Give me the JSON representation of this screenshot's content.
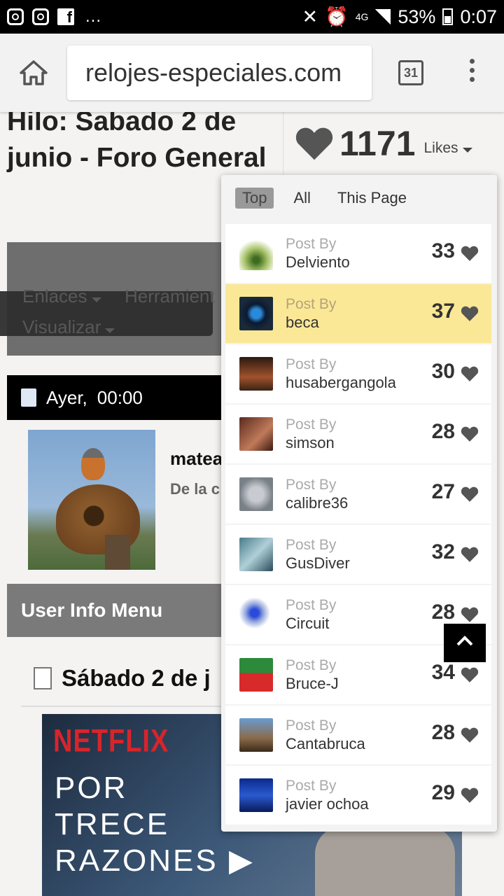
{
  "status_bar": {
    "dots": "...",
    "network": "4G",
    "battery": "53%",
    "time": "0:07"
  },
  "browser": {
    "url": "relojes-especiales.com",
    "tab_count": "31"
  },
  "page": {
    "title": "Hilo: Sabado 2 de junio - Foro General",
    "menu": {
      "links": "Enlaces",
      "tools": "Herramient",
      "view": "Visualizar"
    },
    "post_date": "Ayer,",
    "post_time": "00:00",
    "username": "matea",
    "user_sub": "De la c",
    "user_info_menu": "User Info Menu",
    "post_title": "Sábado 2 de j",
    "banner": {
      "brand": "NETFLIX",
      "line1": "POR",
      "line2": "TRECE",
      "line3": "RAZONES"
    }
  },
  "likes": {
    "count": "1171",
    "label": "Likes",
    "tabs": [
      "Top",
      "All",
      "This Page"
    ],
    "active_tab": "Top",
    "post_by_label": "Post By",
    "heart_color": "#555555",
    "highlight_color": "#fbe896",
    "entries": [
      {
        "poster": "Delviento",
        "count": "33",
        "thumb": "palm-icon"
      },
      {
        "poster": "beca",
        "count": "37",
        "thumb": "watch-icon",
        "highlighted": true
      },
      {
        "poster": "husabergangola",
        "count": "30",
        "thumb": "motorcycle-icon"
      },
      {
        "poster": "simson",
        "count": "28",
        "thumb": "portrait-icon"
      },
      {
        "poster": "calibre36",
        "count": "27",
        "thumb": "chronograph-icon"
      },
      {
        "poster": "GusDiver",
        "count": "32",
        "thumb": "shark-icon"
      },
      {
        "poster": "Circuit",
        "count": "28",
        "thumb": "skull-icon"
      },
      {
        "poster": "Bruce-J",
        "count": "34",
        "thumb": "re-bruce-logo"
      },
      {
        "poster": "Cantabruca",
        "count": "28",
        "thumb": "mountain-icon"
      },
      {
        "poster": "javier ochoa",
        "count": "29",
        "thumb": "silhouette-icon"
      }
    ]
  }
}
